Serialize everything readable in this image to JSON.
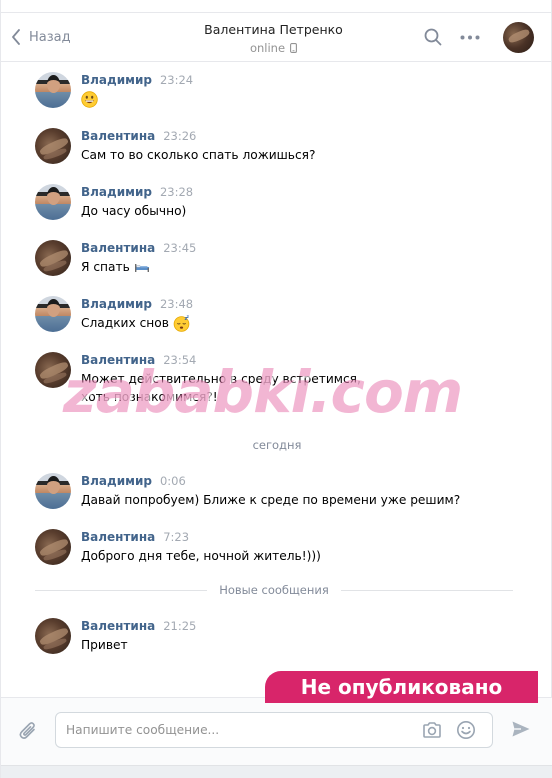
{
  "header": {
    "back_label": "Назад",
    "peer_name": "Валентина Петренко",
    "peer_status": "online"
  },
  "messages": [
    {
      "author": "Владимир",
      "time": "23:24",
      "text": "",
      "emoji": "grinning-face"
    },
    {
      "author": "Валентина",
      "time": "23:26",
      "text": "Сам то во сколько спать ложишься?"
    },
    {
      "author": "Владимир",
      "time": "23:28",
      "text": "До часу обычно)"
    },
    {
      "author": "Валентина",
      "time": "23:45",
      "text": "Я спать",
      "emoji": "bed"
    },
    {
      "author": "Владимир",
      "time": "23:48",
      "text": "Сладких снов",
      "emoji": "sleeping-face"
    },
    {
      "author": "Валентина",
      "time": "23:54",
      "text": "Может действительно в среду встретимся, хоть познакомимся?!"
    },
    {
      "author": "Владимир",
      "time": "0:06",
      "text": "Давай попробуем) Ближе к среде по времени уже решим?"
    },
    {
      "author": "Валентина",
      "time": "7:23",
      "text": "Доброго дня тебе, ночной житель!)))"
    },
    {
      "author": "Валентина",
      "time": "21:25",
      "text": "Привет"
    }
  ],
  "dividers": {
    "date": "сегодня",
    "new_messages": "Новые сообщения"
  },
  "composer": {
    "placeholder": "Напишите сообщение..."
  },
  "overlays": {
    "watermark": "zababki.com",
    "stamp": "Не опубликовано"
  },
  "colors": {
    "author": "#42648b",
    "stamp_bg": "#d8256a",
    "watermark": "#e87aaf"
  }
}
